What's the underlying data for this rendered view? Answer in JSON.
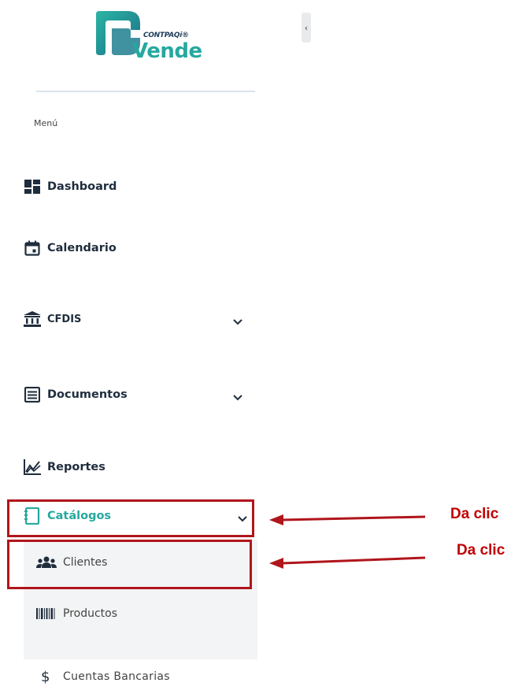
{
  "logo": {
    "brand_small": "CONTPAQi®",
    "brand_big": "Vende"
  },
  "menu": {
    "title": "Menú",
    "items": [
      {
        "label": "Dashboard",
        "icon": "dashboard-icon"
      },
      {
        "label": "Calendario",
        "icon": "calendar-icon"
      },
      {
        "label": "CFDIS",
        "icon": "bank-icon",
        "expandable": true
      },
      {
        "label": "Documentos",
        "icon": "list-icon",
        "expandable": true
      },
      {
        "label": "Reportes",
        "icon": "chart-icon"
      },
      {
        "label": "Catálogos",
        "icon": "book-icon",
        "expandable": true,
        "active": true
      }
    ],
    "submenu": [
      {
        "label": "Clientes",
        "icon": "users-icon"
      },
      {
        "label": "Productos",
        "icon": "barcode-icon"
      },
      {
        "label": "Cuentas Bancarias",
        "icon": "dollar-icon"
      }
    ]
  },
  "callouts": [
    {
      "text": "Da clic"
    },
    {
      "text": "Da clic"
    }
  ],
  "colors": {
    "accent": "#25a89f",
    "annotation": "#b0151b",
    "text": "#1f2d3d"
  }
}
